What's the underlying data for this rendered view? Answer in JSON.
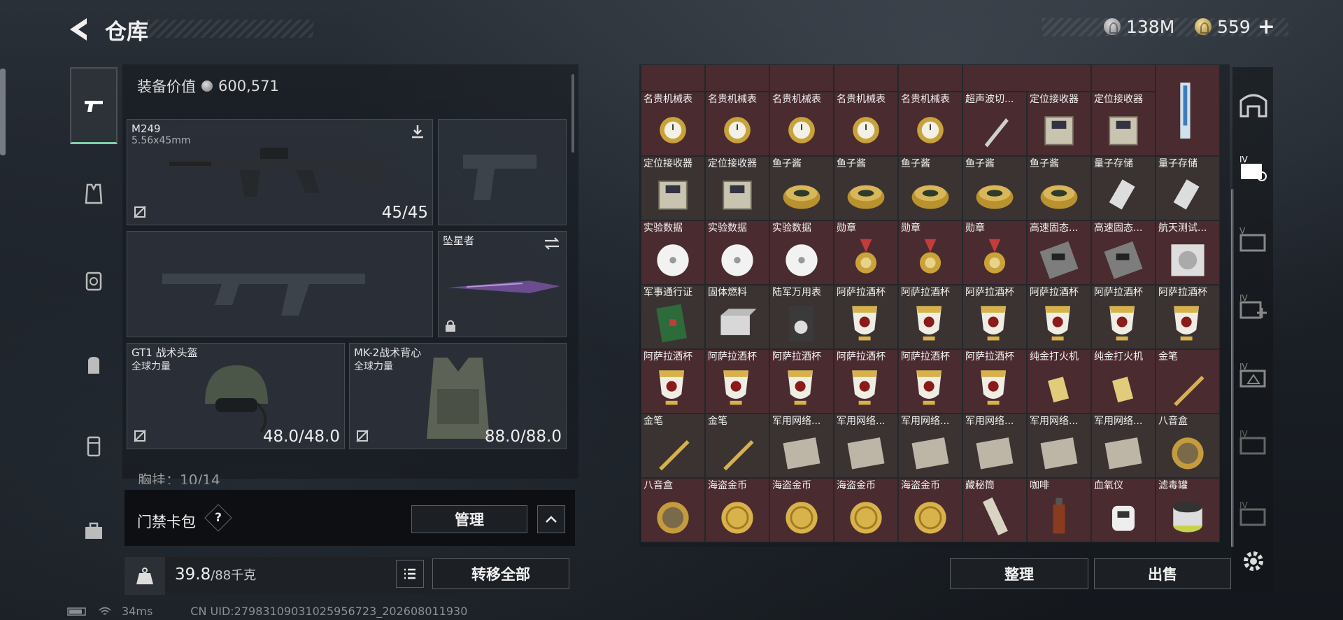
{
  "header": {
    "title": "仓库"
  },
  "currencies": [
    {
      "icon": "silver-coin-icon",
      "amount": "138M"
    },
    {
      "icon": "gold-coin-icon",
      "amount": "559"
    }
  ],
  "equipment": {
    "value_label": "装备价值",
    "value": "600,571",
    "primary": {
      "name": "M249",
      "ammo": "5.56x45mm",
      "count": "45/45"
    },
    "melee": {
      "name": "坠星者"
    },
    "helmet": {
      "name": "GT1 战术头盔",
      "brand": "全球力量",
      "durability": "48.0/48.0"
    },
    "vest": {
      "name": "MK-2战术背心",
      "brand": "全球力量",
      "durability": "88.0/88.0"
    },
    "chest_partial": "胸挂：10/14",
    "access_card": {
      "label": "门禁卡包",
      "help": "?",
      "manage": "管理"
    },
    "weight": {
      "current": "39.8",
      "max": "/88千克"
    },
    "transfer_all": "转移全部"
  },
  "storage": {
    "rows": [
      [
        "名贵机械表",
        "名贵机械表",
        "名贵机械表",
        "名贵机械表",
        "名贵机械表",
        "超声波切...",
        "定位接收器",
        "定位接收器",
        ""
      ],
      [
        "定位接收器",
        "定位接收器",
        "鱼子酱",
        "鱼子酱",
        "鱼子酱",
        "鱼子酱",
        "鱼子酱",
        "量子存储",
        "量子存储"
      ],
      [
        "实验数据",
        "实验数据",
        "实验数据",
        "勋章",
        "勋章",
        "勋章",
        "高速固态...",
        "高速固态...",
        "航天测试..."
      ],
      [
        "军事通行证",
        "固体燃料",
        "陆军万用表",
        "阿萨拉酒杯",
        "阿萨拉酒杯",
        "阿萨拉酒杯",
        "阿萨拉酒杯",
        "阿萨拉酒杯",
        "阿萨拉酒杯"
      ],
      [
        "阿萨拉酒杯",
        "阿萨拉酒杯",
        "阿萨拉酒杯",
        "阿萨拉酒杯",
        "阿萨拉酒杯",
        "阿萨拉酒杯",
        "纯金打火机",
        "纯金打火机",
        "金笔"
      ],
      [
        "金笔",
        "金笔",
        "军用网络...",
        "军用网络...",
        "军用网络...",
        "军用网络...",
        "军用网络...",
        "军用网络...",
        "八音盒"
      ],
      [
        "八音盒",
        "海盗金币",
        "海盗金币",
        "海盗金币",
        "海盗金币",
        "藏秘筒",
        "咖啡",
        "血氧仪",
        "滤毒罐"
      ]
    ],
    "sort": "整理",
    "sell": "出售"
  },
  "footer": {
    "ping": "34ms",
    "uid": "CN UID:2798310903102595672​3_202608011930"
  }
}
